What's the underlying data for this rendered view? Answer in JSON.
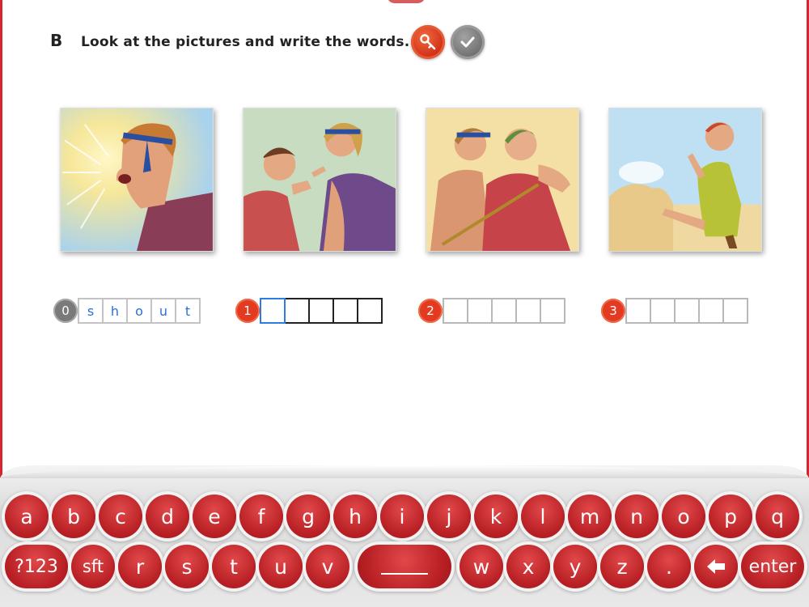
{
  "exercise": {
    "letter": "B",
    "instruction": "Look at the pictures and write the words."
  },
  "toolbar": {
    "key_icon": "key-icon",
    "check_icon": "checkmark-icon"
  },
  "pictures": [
    {
      "name": "shouting-boy-picture"
    },
    {
      "name": "arguing-boys-picture"
    },
    {
      "name": "fighting-boys-picture"
    },
    {
      "name": "kicking-sandcastle-picture"
    }
  ],
  "answers": [
    {
      "number": "0",
      "letters": [
        "s",
        "h",
        "o",
        "u",
        "t"
      ]
    },
    {
      "number": "1",
      "letters": [
        "",
        "",
        "",
        "",
        ""
      ]
    },
    {
      "number": "2",
      "letters": [
        "",
        "",
        "",
        "",
        ""
      ]
    },
    {
      "number": "3",
      "letters": [
        "",
        "",
        "",
        "",
        ""
      ]
    }
  ],
  "keyboard": {
    "row1": [
      "a",
      "b",
      "c",
      "d",
      "e",
      "f",
      "g",
      "h",
      "i",
      "j",
      "k",
      "l",
      "m",
      "n",
      "o",
      "p",
      "q"
    ],
    "row2_left": [
      "?123",
      "sft",
      "r",
      "s",
      "t",
      "u",
      "v"
    ],
    "row2_right": [
      "w",
      "x",
      "y",
      "z",
      "."
    ],
    "backspace_icon": "backspace-arrow-icon",
    "enter": "enter"
  },
  "colors": {
    "accent_red": "#d7262d",
    "typed_letter": "#2a6fd6"
  }
}
